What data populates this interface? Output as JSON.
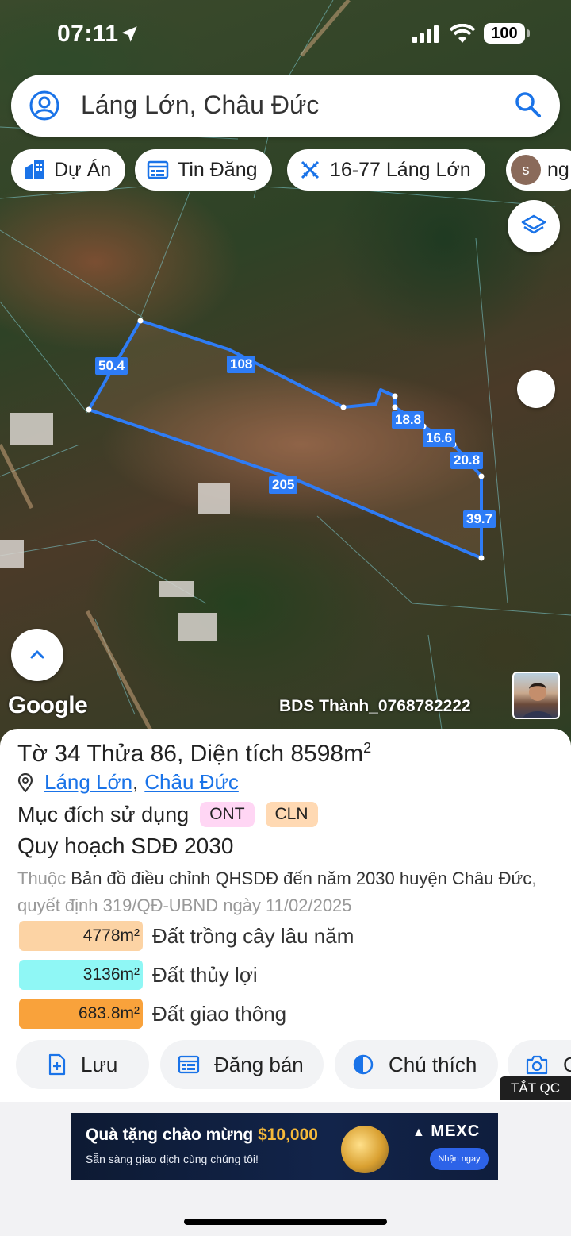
{
  "status_bar": {
    "time": "07:11",
    "battery": "100"
  },
  "search": {
    "query": "Láng Lớn, Châu Đức"
  },
  "chips": [
    {
      "label": "Dự Án",
      "icon": "building-icon"
    },
    {
      "label": "Tin Đăng",
      "icon": "listing-icon"
    },
    {
      "label": "16-77 Láng Lớn",
      "icon": "ruler-icon"
    },
    {
      "label": "ng",
      "avatar_letter": "s"
    }
  ],
  "map": {
    "google_logo": "Google",
    "watermark": "BDS Thành_0768782222",
    "edge_lengths": [
      "50.4",
      "108",
      "18.8",
      "16.6",
      "20.8",
      "205",
      "39.7"
    ],
    "polygon_color": "#2e7cf6"
  },
  "parcel": {
    "title_prefix": "Tờ 34 Thửa 86, Diện tích 8598m",
    "title_sup": "2",
    "locations": [
      "Láng Lớn",
      "Châu Đức"
    ],
    "comma": ",",
    "purpose_label": "Mục đích sử dụng",
    "purpose_badges": [
      "ONT",
      "CLN"
    ],
    "plan_title": "Quy hoạch SDĐ 2030",
    "plan_prefix": "Thuộc",
    "plan_doc": "Bản đồ điều chỉnh QHSDĐ đến năm 2030 huyện Châu Đức",
    "plan_decision": ", quyết định 319/QĐ-UBND ngày 11/02/2025",
    "areas": [
      {
        "value": "4778m²",
        "label": "Đất trồng cây lâu năm",
        "color": "#fcd3a4"
      },
      {
        "value": "3136m²",
        "label": "Đất thủy lợi",
        "color": "#8ff7f5"
      },
      {
        "value": "683.8m²",
        "label": "Đất giao thông",
        "color": "#f9a23b"
      }
    ]
  },
  "actions": [
    {
      "label": "Lưu",
      "icon": "save-icon"
    },
    {
      "label": "Đăng bán",
      "icon": "post-icon"
    },
    {
      "label": "Chú thích",
      "icon": "legend-icon"
    },
    {
      "label": "C",
      "icon": "camera-icon"
    }
  ],
  "ad_close": "TẮT QC",
  "ad": {
    "title_prefix": "Quà tặng chào mừng ",
    "title_amount": "$10,000",
    "subtitle": "Sẵn sàng giao dịch cùng chúng tôi!",
    "brand": "MEXC",
    "cta": "Nhận ngay"
  }
}
